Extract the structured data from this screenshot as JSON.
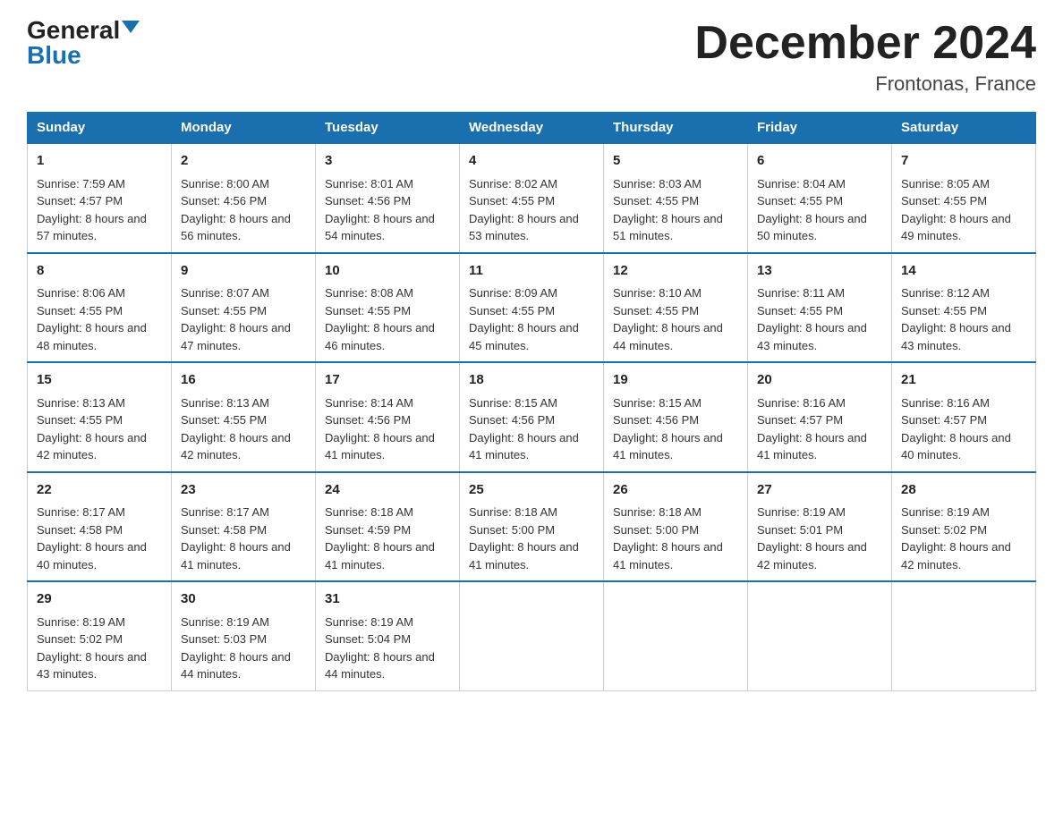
{
  "header": {
    "logo_general": "General",
    "logo_blue": "Blue",
    "title": "December 2024",
    "location": "Frontonas, France"
  },
  "weekdays": [
    "Sunday",
    "Monday",
    "Tuesday",
    "Wednesday",
    "Thursday",
    "Friday",
    "Saturday"
  ],
  "weeks": [
    [
      {
        "day": "1",
        "sunrise": "7:59 AM",
        "sunset": "4:57 PM",
        "daylight": "8 hours and 57 minutes."
      },
      {
        "day": "2",
        "sunrise": "8:00 AM",
        "sunset": "4:56 PM",
        "daylight": "8 hours and 56 minutes."
      },
      {
        "day": "3",
        "sunrise": "8:01 AM",
        "sunset": "4:56 PM",
        "daylight": "8 hours and 54 minutes."
      },
      {
        "day": "4",
        "sunrise": "8:02 AM",
        "sunset": "4:55 PM",
        "daylight": "8 hours and 53 minutes."
      },
      {
        "day": "5",
        "sunrise": "8:03 AM",
        "sunset": "4:55 PM",
        "daylight": "8 hours and 51 minutes."
      },
      {
        "day": "6",
        "sunrise": "8:04 AM",
        "sunset": "4:55 PM",
        "daylight": "8 hours and 50 minutes."
      },
      {
        "day": "7",
        "sunrise": "8:05 AM",
        "sunset": "4:55 PM",
        "daylight": "8 hours and 49 minutes."
      }
    ],
    [
      {
        "day": "8",
        "sunrise": "8:06 AM",
        "sunset": "4:55 PM",
        "daylight": "8 hours and 48 minutes."
      },
      {
        "day": "9",
        "sunrise": "8:07 AM",
        "sunset": "4:55 PM",
        "daylight": "8 hours and 47 minutes."
      },
      {
        "day": "10",
        "sunrise": "8:08 AM",
        "sunset": "4:55 PM",
        "daylight": "8 hours and 46 minutes."
      },
      {
        "day": "11",
        "sunrise": "8:09 AM",
        "sunset": "4:55 PM",
        "daylight": "8 hours and 45 minutes."
      },
      {
        "day": "12",
        "sunrise": "8:10 AM",
        "sunset": "4:55 PM",
        "daylight": "8 hours and 44 minutes."
      },
      {
        "day": "13",
        "sunrise": "8:11 AM",
        "sunset": "4:55 PM",
        "daylight": "8 hours and 43 minutes."
      },
      {
        "day": "14",
        "sunrise": "8:12 AM",
        "sunset": "4:55 PM",
        "daylight": "8 hours and 43 minutes."
      }
    ],
    [
      {
        "day": "15",
        "sunrise": "8:13 AM",
        "sunset": "4:55 PM",
        "daylight": "8 hours and 42 minutes."
      },
      {
        "day": "16",
        "sunrise": "8:13 AM",
        "sunset": "4:55 PM",
        "daylight": "8 hours and 42 minutes."
      },
      {
        "day": "17",
        "sunrise": "8:14 AM",
        "sunset": "4:56 PM",
        "daylight": "8 hours and 41 minutes."
      },
      {
        "day": "18",
        "sunrise": "8:15 AM",
        "sunset": "4:56 PM",
        "daylight": "8 hours and 41 minutes."
      },
      {
        "day": "19",
        "sunrise": "8:15 AM",
        "sunset": "4:56 PM",
        "daylight": "8 hours and 41 minutes."
      },
      {
        "day": "20",
        "sunrise": "8:16 AM",
        "sunset": "4:57 PM",
        "daylight": "8 hours and 41 minutes."
      },
      {
        "day": "21",
        "sunrise": "8:16 AM",
        "sunset": "4:57 PM",
        "daylight": "8 hours and 40 minutes."
      }
    ],
    [
      {
        "day": "22",
        "sunrise": "8:17 AM",
        "sunset": "4:58 PM",
        "daylight": "8 hours and 40 minutes."
      },
      {
        "day": "23",
        "sunrise": "8:17 AM",
        "sunset": "4:58 PM",
        "daylight": "8 hours and 41 minutes."
      },
      {
        "day": "24",
        "sunrise": "8:18 AM",
        "sunset": "4:59 PM",
        "daylight": "8 hours and 41 minutes."
      },
      {
        "day": "25",
        "sunrise": "8:18 AM",
        "sunset": "5:00 PM",
        "daylight": "8 hours and 41 minutes."
      },
      {
        "day": "26",
        "sunrise": "8:18 AM",
        "sunset": "5:00 PM",
        "daylight": "8 hours and 41 minutes."
      },
      {
        "day": "27",
        "sunrise": "8:19 AM",
        "sunset": "5:01 PM",
        "daylight": "8 hours and 42 minutes."
      },
      {
        "day": "28",
        "sunrise": "8:19 AM",
        "sunset": "5:02 PM",
        "daylight": "8 hours and 42 minutes."
      }
    ],
    [
      {
        "day": "29",
        "sunrise": "8:19 AM",
        "sunset": "5:02 PM",
        "daylight": "8 hours and 43 minutes."
      },
      {
        "day": "30",
        "sunrise": "8:19 AM",
        "sunset": "5:03 PM",
        "daylight": "8 hours and 44 minutes."
      },
      {
        "day": "31",
        "sunrise": "8:19 AM",
        "sunset": "5:04 PM",
        "daylight": "8 hours and 44 minutes."
      },
      null,
      null,
      null,
      null
    ]
  ]
}
